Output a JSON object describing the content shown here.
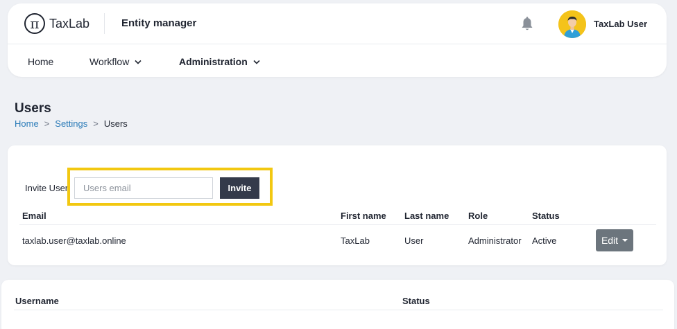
{
  "header": {
    "logo_glyph": "π",
    "logo_text": "TaxLab",
    "app_title": "Entity manager",
    "user_name": "TaxLab User",
    "icons": {
      "notifications": "bell-icon",
      "avatar": "user-avatar"
    }
  },
  "nav": {
    "items": [
      {
        "label": "Home",
        "has_dropdown": false
      },
      {
        "label": "Workflow",
        "has_dropdown": true
      },
      {
        "label": "Administration",
        "has_dropdown": true,
        "active": true
      }
    ]
  },
  "page": {
    "title": "Users",
    "breadcrumb": [
      "Home",
      "Settings",
      "Users"
    ],
    "breadcrumb_sep": ">"
  },
  "invite": {
    "label": "Invite User",
    "placeholder": "Users email",
    "value": "",
    "button_label": "Invite"
  },
  "users_table": {
    "columns": [
      "Email",
      "First name",
      "Last name",
      "Role",
      "Status"
    ],
    "rows": [
      {
        "email": "taxlab.user@taxlab.online",
        "first_name": "TaxLab",
        "last_name": "User",
        "role": "Administrator",
        "status": "Active",
        "action_label": "Edit"
      }
    ]
  },
  "second_table": {
    "columns": [
      "Username",
      "Status"
    ]
  },
  "colors": {
    "background": "#eff1f5",
    "primary_dark": "#343a4a",
    "link": "#2a7bb8",
    "highlight": "#f2c811",
    "edit_button": "#6c757d",
    "avatar_bg": "#f4c31a"
  }
}
